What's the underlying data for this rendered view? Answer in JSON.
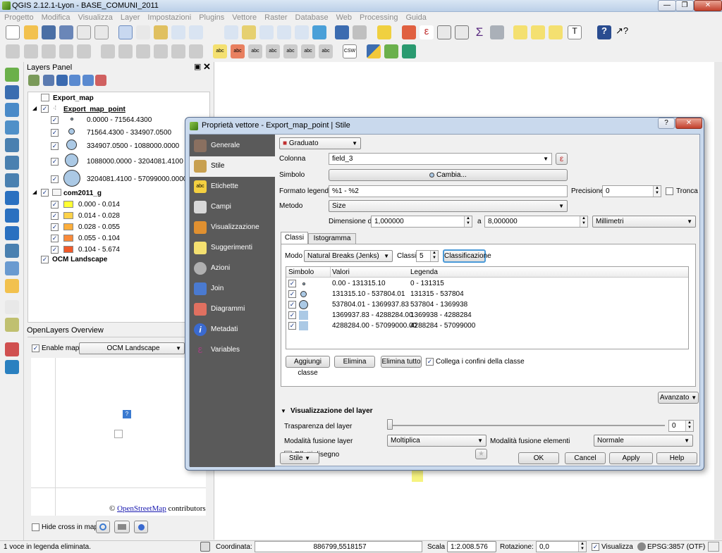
{
  "window": {
    "title": "QGIS 2.12.1-Lyon - BASE_COMUNI_2011"
  },
  "menubar": [
    "Progetto",
    "Modifica",
    "Visualizza",
    "Layer",
    "Impostazioni",
    "Plugins",
    "Vettore",
    "Raster",
    "Database",
    "Web",
    "Processing",
    "Guida"
  ],
  "layers_panel": {
    "title": "Layers Panel",
    "layers": [
      {
        "name": "Export_map"
      },
      {
        "name": "Export_map_point",
        "classes": [
          "0.0000 - 71564.4300",
          "71564.4300 - 334907.0500",
          "334907.0500 - 1088000.0000",
          "1088000.0000 - 3204081.4100",
          "3204081.4100 - 57099000.0000"
        ]
      },
      {
        "name": "com2011_g",
        "classes": [
          {
            "label": "0.000 - 0.014",
            "color": "#ffff33"
          },
          {
            "label": "0.014 - 0.028",
            "color": "#fed24a"
          },
          {
            "label": "0.028 - 0.055",
            "color": "#fdae3c"
          },
          {
            "label": "0.055 - 0.104",
            "color": "#f98a3a"
          },
          {
            "label": "0.104 - 5.674",
            "color": "#f05a2a"
          }
        ]
      },
      {
        "name": "OCM Landscape"
      }
    ]
  },
  "overview_panel": {
    "title": "OpenLayers Overview",
    "enable_label": "Enable map",
    "map_select": "OCM Landscape",
    "attribution_prefix": "©",
    "attribution_link": "OpenStreetMap",
    "attribution_suffix": "contributors",
    "hide_cross": "Hide cross in map"
  },
  "dialog": {
    "title": "Proprietà vettore - Export_map_point | Stile",
    "sidebar": [
      "Generale",
      "Stile",
      "Etichette",
      "Campi",
      "Visualizzazione",
      "Suggerimenti",
      "Azioni",
      "Join",
      "Diagrammi",
      "Metadati",
      "Variables"
    ],
    "renderer": "Graduato",
    "colonna_label": "Colonna",
    "colonna_value": "field_3",
    "simbolo_label": "Simbolo",
    "cambia": "Cambia...",
    "formato_label": "Formato legenda",
    "formato_value": "%1 - %2",
    "precisione_label": "Precisione",
    "precisione_value": "0",
    "tronca": "Tronca",
    "metodo_label": "Metodo",
    "metodo_value": "Size",
    "dimensione_label": "Dimensione da",
    "dim_from": "1,000000",
    "a_label": "a",
    "dim_to": "8,000000",
    "unit": "Millimetri",
    "tabs": [
      "Classi",
      "Istogramma"
    ],
    "modo_label": "Modo",
    "modo_value": "Natural Breaks (Jenks)",
    "classi_label": "Classi",
    "classi_value": "5",
    "classificazione": "Classificazione",
    "table_headers": [
      "Simbolo",
      "Valori",
      "Legenda"
    ],
    "rows": [
      {
        "valori": "0.00 - 131315.10",
        "legenda": "0 - 131315"
      },
      {
        "valori": "131315.10 - 537804.01",
        "legenda": "131315 - 537804"
      },
      {
        "valori": "537804.01 - 1369937.83",
        "legenda": "537804 - 1369938"
      },
      {
        "valori": "1369937.83 - 4288284.00",
        "legenda": "1369938 - 4288284"
      },
      {
        "valori": "4288284.00 - 57099000.00",
        "legenda": "4288284 - 57099000"
      }
    ],
    "aggiungi": "Aggiungi classe",
    "elimina": "Elimina",
    "elimina_tutto": "Elimina tutto",
    "collega": "Collega i confini della classe",
    "avanzato": "Avanzato",
    "vis_layer": "Visualizzazione del layer",
    "trasparenza_label": "Trasparenza del layer",
    "trasparenza_value": "0",
    "fusione_layer_label": "Modalità fusione layer",
    "fusione_layer_value": "Moltiplica",
    "fusione_elementi_label": "Modalità fusione elementi",
    "fusione_elementi_value": "Normale",
    "effetti": "Effetti disegno",
    "stile_btn": "Stile",
    "ok": "OK",
    "cancel": "Cancel",
    "apply": "Apply",
    "help": "Help"
  },
  "statusbar": {
    "message": "1 voce in legenda eliminata.",
    "coord_label": "Coordinata:",
    "coord_value": "886799,5518157",
    "scala_label": "Scala",
    "scala_value": "1:2.008.576",
    "rot_label": "Rotazione:",
    "rot_value": "0,0",
    "visualizza": "Visualizza",
    "epsg": "EPSG:3857 (OTF)"
  }
}
